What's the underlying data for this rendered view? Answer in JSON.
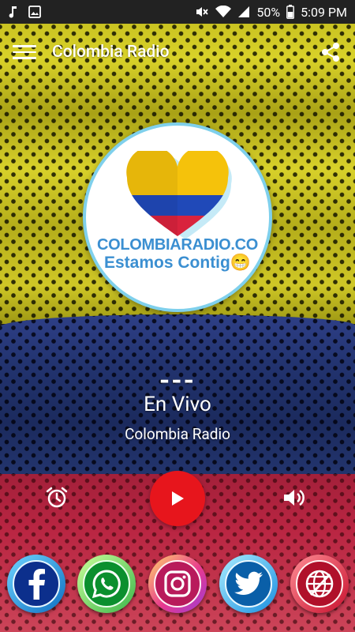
{
  "status_bar": {
    "icons_left": [
      "music-note-icon",
      "image-icon"
    ],
    "icons_right": [
      "mute-icon",
      "wifi-icon",
      "cell-signal-icon"
    ],
    "battery": "50%",
    "time": "5:09 PM"
  },
  "app_bar": {
    "title": "Colombia Radio",
    "menu_icon": "hamburger-menu-icon",
    "share_icon": "share-icon"
  },
  "logo": {
    "line1": "COLOMBIARADIO.CO",
    "line2": "Estamos Contig😁",
    "heart_colors": [
      "#f5c20b",
      "#2049b8",
      "#d9233d"
    ]
  },
  "now_playing": {
    "dashes": "---",
    "title": "En Vivo",
    "station": "Colombia Radio"
  },
  "controls": {
    "alarm_icon": "alarm-clock-icon",
    "play_icon": "play-icon",
    "volume_icon": "volume-icon",
    "play_color": "#e7151c"
  },
  "social": [
    {
      "name": "facebook",
      "icon": "facebook-icon"
    },
    {
      "name": "whatsapp",
      "icon": "whatsapp-icon"
    },
    {
      "name": "instagram",
      "icon": "instagram-icon"
    },
    {
      "name": "twitter",
      "icon": "twitter-icon"
    },
    {
      "name": "website",
      "icon": "globe-icon"
    }
  ],
  "colors": {
    "flag_yellow": "#d9d229",
    "flag_blue": "#22336f",
    "flag_red": "#b92542",
    "logo_text": "#3b8fd1",
    "logo_border": "#7fd0ec"
  }
}
